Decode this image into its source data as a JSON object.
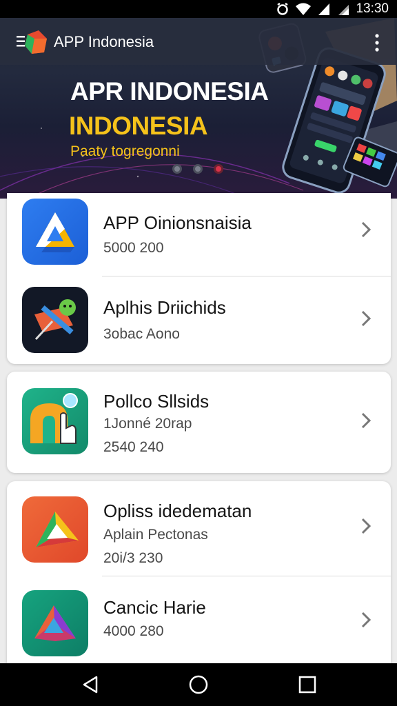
{
  "status_bar": {
    "time": "13:30",
    "icons": [
      "alarm-icon",
      "wifi-icon",
      "signal-icon",
      "battery-icon"
    ]
  },
  "app_bar": {
    "title": "APP Indonesia",
    "icons": [
      "menu-icon",
      "more-vert-icon"
    ]
  },
  "banner": {
    "title_line1": "APR INDONESIA",
    "title_line2": "INDONESIA",
    "subtitle": "Paaty togregonni",
    "carousel_pages": 3,
    "active_page": 3
  },
  "apps": [
    {
      "title": "APP Oinionsnaisia",
      "subtitle": "",
      "meta": "5000 200"
    },
    {
      "title": "Aplhis Driichids",
      "subtitle": "",
      "meta": "3obac Aono"
    },
    {
      "title": "Pollco Sllsids",
      "subtitle": "1Jonné 20rap",
      "meta": "2540 240"
    },
    {
      "title": "Opliss idedematan",
      "subtitle": "Aplain Pectonas",
      "meta": "20i/3 230"
    },
    {
      "title": "Cancic Harie",
      "subtitle": "",
      "meta": "4000 280"
    }
  ],
  "nav_bar": {
    "buttons": [
      "back-icon",
      "home-icon",
      "recents-icon"
    ]
  },
  "colors": {
    "accent": "#f5c21b",
    "active_dot": "#d8334a",
    "banner_bg": "#202534"
  }
}
